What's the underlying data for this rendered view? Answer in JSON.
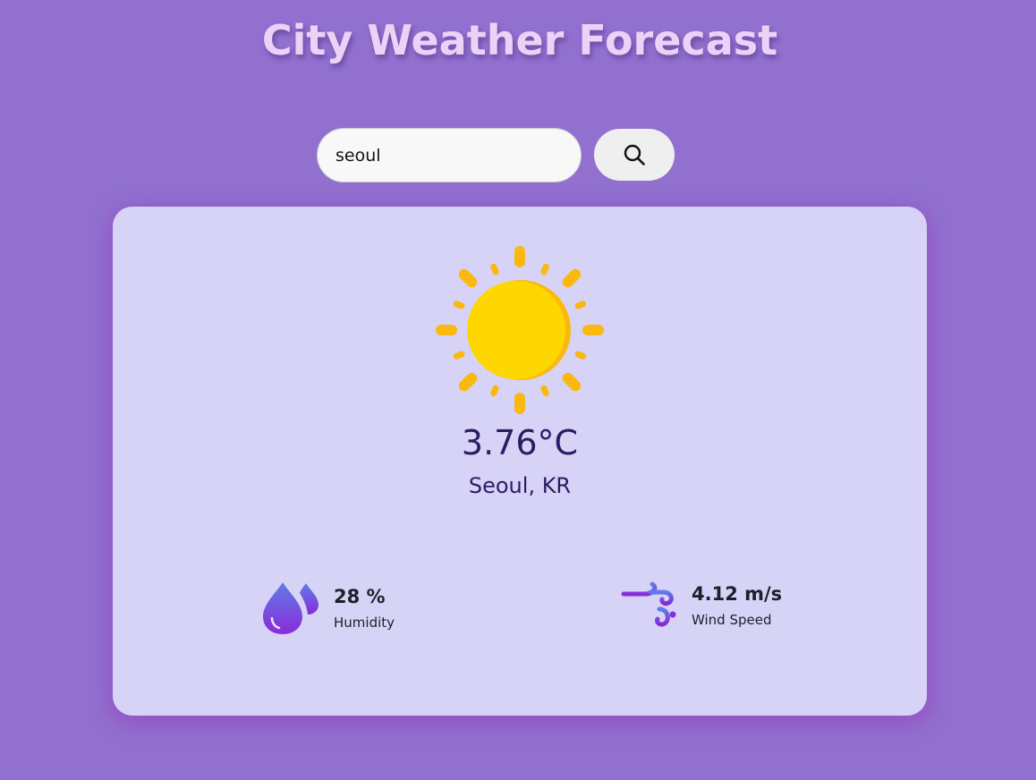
{
  "header": {
    "title": "City Weather Forecast"
  },
  "search": {
    "value": "seoul",
    "button_icon": "search-icon"
  },
  "weather": {
    "condition_icon": "sun-icon",
    "temperature": "3.76°C",
    "location": "Seoul, KR"
  },
  "stats": {
    "humidity": {
      "icon": "water-drops-icon",
      "value": "28 %",
      "label": "Humidity"
    },
    "wind": {
      "icon": "wind-icon",
      "value": "4.12 m/s",
      "label": "Wind Speed"
    }
  },
  "colors": {
    "background": "#9170cf",
    "card": "#d6d3f6",
    "title": "#ecd2f7",
    "text_primary": "#2b1d63",
    "sun": "#ffd700",
    "sun_rays": "#fbb80e",
    "icon_gradient_top": "#5d7de8",
    "icon_gradient_bottom": "#8a2bd8"
  }
}
